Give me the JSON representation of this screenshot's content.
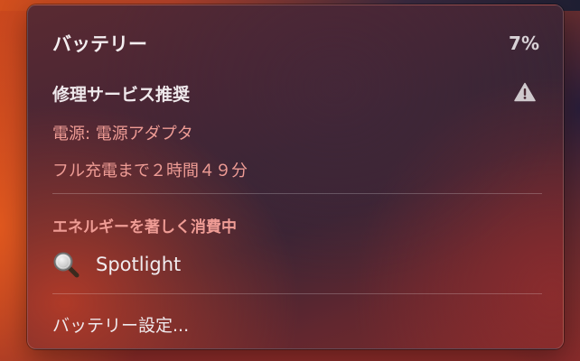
{
  "battery_menu": {
    "title": "バッテリー",
    "percent": "7%",
    "service_label": "修理サービス推奨",
    "power_source": "電源: 電源アダプタ",
    "time_to_full": "フル充電まで２時間４９分",
    "energy_heading": "エネルギーを著しく消費中",
    "apps": [
      {
        "name": "Spotlight",
        "icon": "magnifier-icon"
      }
    ],
    "settings_label": "バッテリー設定..."
  },
  "icons": {
    "warning": "warning-triangle-icon",
    "app": "magnifier-icon"
  },
  "colors": {
    "accent_text": "#ef9c95",
    "primary_text": "#efe9ec"
  }
}
